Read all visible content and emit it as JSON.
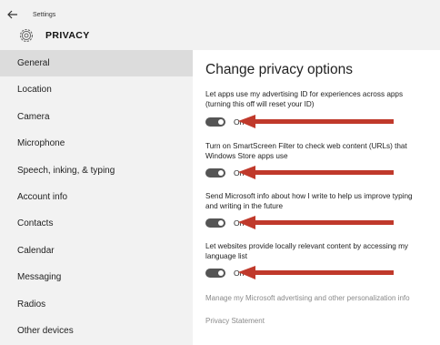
{
  "window": {
    "title": "Settings",
    "back_icon": "back-arrow-icon"
  },
  "header": {
    "icon": "gear-icon",
    "page_title": "PRIVACY"
  },
  "sidebar": {
    "items": [
      {
        "label": "General",
        "active": true
      },
      {
        "label": "Location"
      },
      {
        "label": "Camera"
      },
      {
        "label": "Microphone"
      },
      {
        "label": "Speech, inking, & typing"
      },
      {
        "label": "Account info"
      },
      {
        "label": "Contacts"
      },
      {
        "label": "Calendar"
      },
      {
        "label": "Messaging"
      },
      {
        "label": "Radios"
      },
      {
        "label": "Other devices"
      }
    ]
  },
  "main": {
    "title": "Change privacy options",
    "settings": [
      {
        "line1": "Let apps use my advertising ID for experiences across apps",
        "line2": "(turning this off will reset your ID)",
        "state": "On"
      },
      {
        "line1": "Turn on SmartScreen Filter to check web content (URLs) that",
        "line2": "Windows Store apps use",
        "state": "On"
      },
      {
        "line1": "Send Microsoft info about how I write to help us improve typing",
        "line2": "and writing in the future",
        "state": "On"
      },
      {
        "line1": "Let websites provide locally relevant content by accessing my",
        "line2": "language list",
        "state": "On"
      }
    ],
    "links": [
      "Manage my Microsoft advertising and other personalization info",
      "Privacy Statement"
    ]
  },
  "colors": {
    "annotation_arrow": "#c0392b",
    "toggle_on": "#555555",
    "sidebar_bg": "#f2f2f2",
    "sidebar_active": "#dcdcdc"
  }
}
